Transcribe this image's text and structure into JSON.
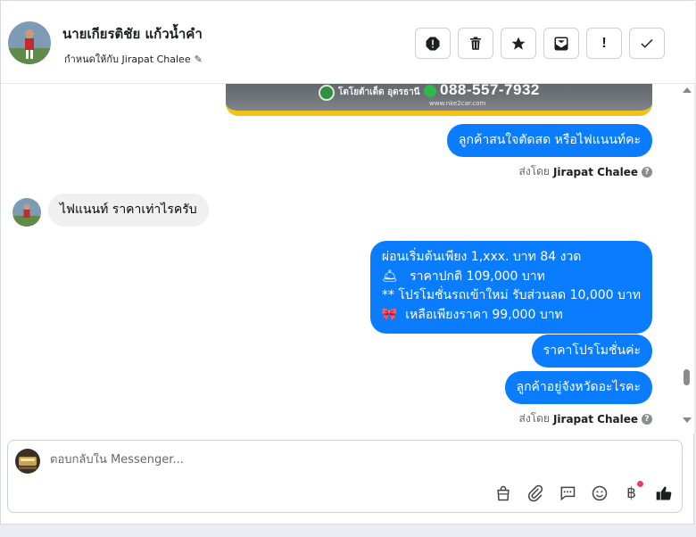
{
  "header": {
    "name": "นายเกียรติชัย แก้วน้ำคำ",
    "assigned": "กำหนดให้กับ Jirapat Chalee",
    "actions": [
      "report-icon",
      "trash-icon",
      "star-icon",
      "archive-icon",
      "exclamation-icon",
      "check-icon"
    ],
    "exclamation": "!"
  },
  "banner": {
    "brand": "โตโยต้าเด็ด อุดรธานี",
    "phone": "088-557-7932",
    "web": "www.nke2car.com"
  },
  "messages": {
    "m1": "ลูกค้าสนใจตัดสด หรือไฟแนนท์คะ",
    "sent1": {
      "prefix": "ส่งโดย",
      "agent": "Jirapat Chalee"
    },
    "m2": "ไฟแนนท์ ราคาเท่าไรครับ",
    "m3": {
      "line1": "ผ่อนเริ่มต้นเพียง 1,xxx. บาท 84 งวด",
      "line2_icon": "🛎",
      "line2": "ราคาปกติ 109,000 บาท",
      "line3": "** โปรโมชั่นรถเข้าใหม่ รับส่วนลด 10,000 บาท",
      "line4_icon": "🎀",
      "line4": "เหลือเพียงราคา 99,000 บาท"
    },
    "m4": "ราคาโปรโมชั่นค่ะ",
    "m5": "ลูกค้าอยู่จังหวัดอะไรคะ",
    "sent2": {
      "prefix": "ส่งโดย",
      "agent": "Jirapat Chalee"
    }
  },
  "composer": {
    "placeholder": "ตอบกลับใน Messenger...",
    "icons": [
      "bag-icon",
      "attachment-icon",
      "saved-reply-icon",
      "emoji-icon",
      "baht-icon",
      "thumbs-up-icon"
    ],
    "baht": "฿"
  },
  "colors": {
    "accent": "#0a7cff",
    "incoming": "#f0f0f0",
    "notify": "#e4405f"
  }
}
